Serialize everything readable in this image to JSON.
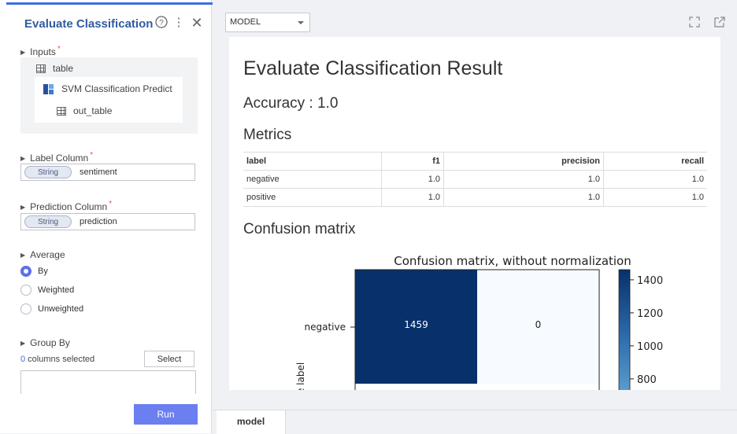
{
  "panel": {
    "title": "Evaluate Classification",
    "inputs_label": "Inputs",
    "input_table": "table",
    "svm_node": "SVM Classification Predict",
    "out_table": "out_table",
    "label_column": {
      "label": "Label Column",
      "type": "String",
      "value": "sentiment"
    },
    "prediction_column": {
      "label": "Prediction Column",
      "type": "String",
      "value": "prediction"
    },
    "average": {
      "label": "Average",
      "options": [
        "By",
        "Weighted",
        "Unweighted"
      ],
      "selected": "By"
    },
    "group_by": {
      "label": "Group By",
      "count": "0",
      "suffix": " columns selected",
      "select_button": "Select"
    },
    "run_button": "Run",
    "required_mark": "*"
  },
  "toolbar": {
    "model_select": "MODEL"
  },
  "report": {
    "title": "Evaluate Classification Result",
    "accuracy": "Accuracy : 1.0",
    "metrics_title": "Metrics",
    "metrics": {
      "columns": [
        "label",
        "f1",
        "precision",
        "recall"
      ],
      "rows": [
        [
          "negative",
          "1.0",
          "1.0",
          "1.0"
        ],
        [
          "positive",
          "1.0",
          "1.0",
          "1.0"
        ]
      ]
    },
    "confusion_title": "Confusion matrix"
  },
  "chart_data": {
    "type": "heatmap",
    "title": "Confusion matrix, without normalization",
    "ylabel": "True label",
    "y_categories_visible": [
      "negative"
    ],
    "cells": [
      [
        1459,
        0
      ]
    ],
    "colorbar_ticks": [
      1400,
      1200,
      1000,
      800
    ],
    "colorbar_range": [
      0,
      1459
    ],
    "colors": {
      "high": "#08306b",
      "low": "#f7fbff"
    }
  },
  "tabs": [
    "model"
  ]
}
